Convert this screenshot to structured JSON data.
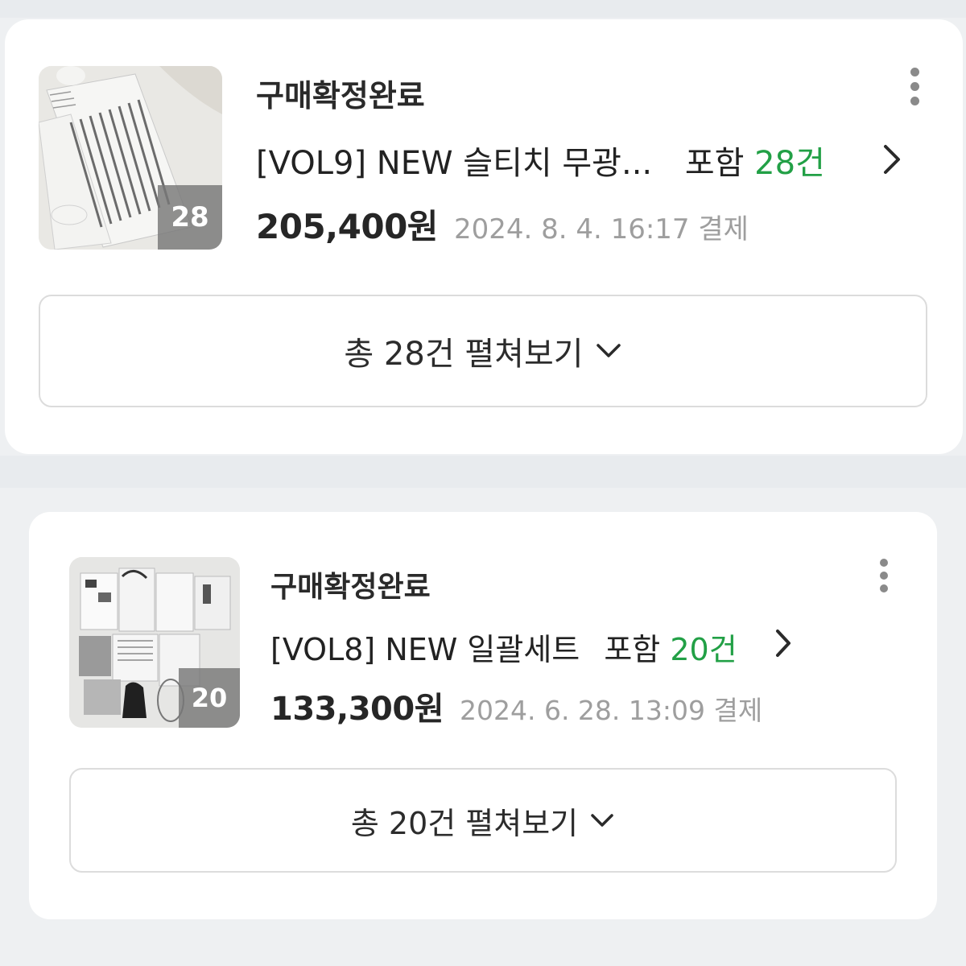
{
  "orders": [
    {
      "status": "구매확정완료",
      "product_title": "[VOL9] NEW 슬티치 무광...",
      "includes_label": "포함",
      "item_count_label": "28건",
      "price": "205,400원",
      "paid_at": "2024. 8. 4. 16:17 결제",
      "thumb_badge": "28",
      "expand_label": "총 28건 펼쳐보기"
    },
    {
      "status": "구매확정완료",
      "product_title": "[VOL8] NEW 일괄세트",
      "includes_label": "포함",
      "item_count_label": "20건",
      "price": "133,300원",
      "paid_at": "2024. 6. 28. 13:09 결제",
      "thumb_badge": "20",
      "expand_label": "총 20건 펼쳐보기"
    }
  ],
  "colors": {
    "accent_green": "#22a046",
    "date_gray": "#9e9e9e",
    "page_background": "#eef0f2"
  },
  "icons": {
    "more": "more-vertical-icon",
    "detail": "chevron-right-icon",
    "expand": "chevron-down-icon"
  }
}
